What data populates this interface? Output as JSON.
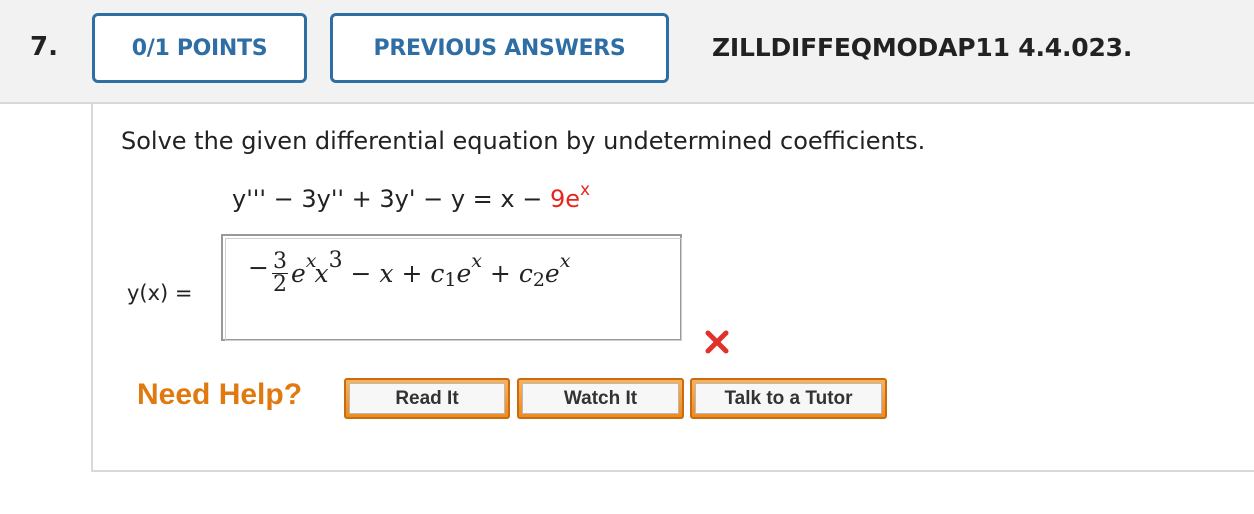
{
  "question": {
    "number": "7.",
    "points_label": "0/1 POINTS",
    "previous_answers_label": "PREVIOUS ANSWERS",
    "problem_id": "ZILLDIFFEQMODAP11 4.4.023."
  },
  "body": {
    "prompt": "Solve the given differential equation by undetermined coefficients.",
    "equation_main": "y''' − 3y'' + 3y' − y = x − ",
    "equation_red": "9e",
    "equation_red_exp": "x",
    "answer_label": "y(x) =",
    "answer": {
      "neg_sign": "−",
      "frac_num": "3",
      "frac_den": "2",
      "term1_base": "e",
      "term1_exp": "x",
      "term1_x": "x",
      "term1_xexp": "3",
      "rest": " − x + c",
      "c1_sub": "1",
      "c1_e": "e",
      "c1_exp": "x",
      "plus": " + c",
      "c2_sub": "2",
      "c2_e": "e",
      "c2_exp": "x"
    },
    "status": "incorrect",
    "status_color": "#e0312c"
  },
  "help": {
    "label": "Need Help?",
    "read_it": "Read It",
    "watch_it": "Watch It",
    "talk_to_tutor": "Talk to a Tutor"
  }
}
